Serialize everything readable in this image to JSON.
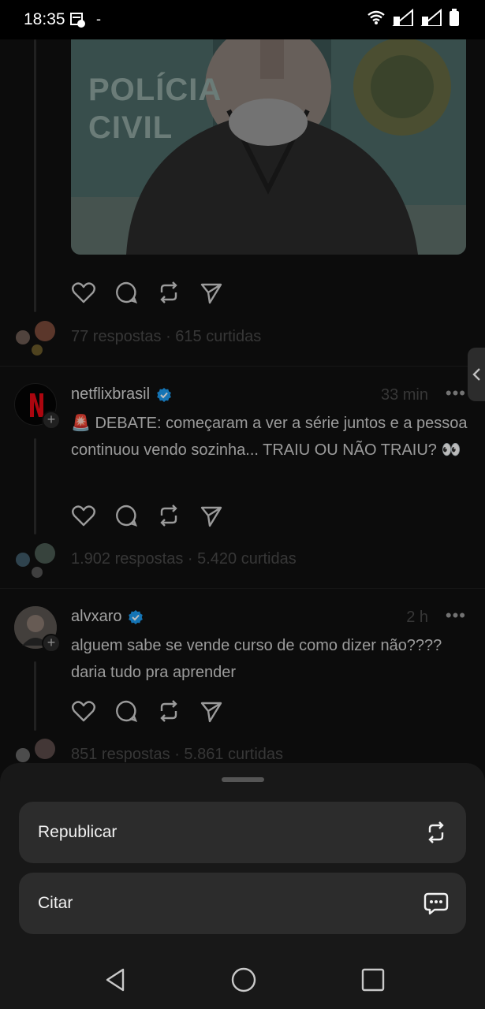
{
  "status_bar": {
    "time": "18:35",
    "dash": "-"
  },
  "posts": [
    {
      "stats": "77 respostas · 615 curtidas",
      "photo_text": "POLÍCIA CIVIL"
    },
    {
      "username": "netflixbrasil",
      "time": "33 min",
      "text": "🚨 DEBATE: começaram a ver a série juntos e a pessoa continuou vendo sozinha... TRAIU OU NÃO TRAIU? 👀",
      "stats": "1.902 respostas · 5.420 curtidas"
    },
    {
      "username": "alvxaro",
      "time": "2 h",
      "text": "alguem sabe se vende curso de como dizer não???? daria tudo pra aprender",
      "stats": "851 respostas · 5.861 curtidas"
    }
  ],
  "sheet": {
    "options": [
      {
        "label": "Republicar",
        "icon": "repost-icon"
      },
      {
        "label": "Citar",
        "icon": "quote-icon"
      }
    ]
  },
  "colors": {
    "verified": "#1d9bf0",
    "netflix": "#e50914"
  }
}
